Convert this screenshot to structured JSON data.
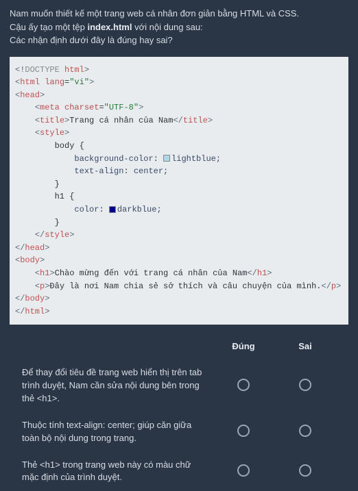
{
  "intro": {
    "line1": "Nam muốn thiết kế một trang web cá nhân đơn giản bằng HTML và CSS.",
    "line2a": "Cậu ấy tạo một tệp ",
    "line2_bold": "index.html",
    "line2b": " với nội dung sau:",
    "line3": "Các nhận định dưới đây là đúng hay sai?"
  },
  "code": {
    "doctype": "<!DOCTYPE html>",
    "html_open_a": "html",
    "html_lang_attr": "lang",
    "html_lang_val": "\"vi\"",
    "head_tag": "head",
    "meta_tag": "meta",
    "meta_attr": "charset",
    "meta_val": "\"UTF-8\"",
    "title_tag": "title",
    "title_text": "Trang cá nhân của Nam",
    "style_tag": "style",
    "sel_body": "body {",
    "prop_bg": "background-color",
    "val_bg": "lightblue;",
    "prop_align": "text-align",
    "val_align": "center;",
    "brace_close": "}",
    "sel_h1": "h1 {",
    "prop_color": "color",
    "val_color": "darkblue;",
    "body_tag": "body",
    "h1_tag": "h1",
    "h1_text": "Chào mừng đến với trang cá nhân của Nam",
    "p_tag": "p",
    "p_text": "Đây là nơi Nam chia sẻ sở thích và câu chuyện của mình."
  },
  "quiz": {
    "header_true": "Đúng",
    "header_false": "Sai",
    "rows": [
      {
        "text": "Để thay đổi tiêu đề trang web hiển thị trên tab trình duyệt, Nam cần sửa nội dung bên trong thẻ <h1>."
      },
      {
        "text": "Thuộc tính text-align: center; giúp căn giữa toàn bộ nội dung trong trang."
      },
      {
        "text": "Thẻ <h1> trong trang web này có màu chữ mặc định của trình duyệt."
      }
    ]
  }
}
